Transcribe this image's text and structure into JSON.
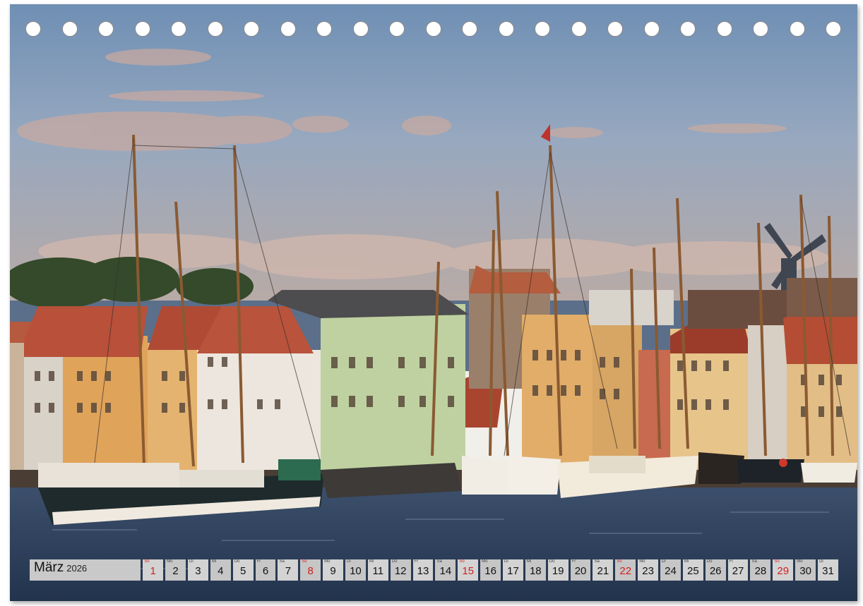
{
  "calendar": {
    "month": "März",
    "year": "2026",
    "sunday_color": "#d41f1f",
    "days": [
      {
        "dow": "So",
        "num": "1",
        "sunday": true
      },
      {
        "dow": "Mo",
        "num": "2",
        "sunday": false
      },
      {
        "dow": "Di",
        "num": "3",
        "sunday": false
      },
      {
        "dow": "Mi",
        "num": "4",
        "sunday": false
      },
      {
        "dow": "Do",
        "num": "5",
        "sunday": false
      },
      {
        "dow": "Fr",
        "num": "6",
        "sunday": false
      },
      {
        "dow": "Sa",
        "num": "7",
        "sunday": false
      },
      {
        "dow": "So",
        "num": "8",
        "sunday": true
      },
      {
        "dow": "Mo",
        "num": "9",
        "sunday": false
      },
      {
        "dow": "Di",
        "num": "10",
        "sunday": false
      },
      {
        "dow": "Mi",
        "num": "11",
        "sunday": false
      },
      {
        "dow": "Do",
        "num": "12",
        "sunday": false
      },
      {
        "dow": "Fr",
        "num": "13",
        "sunday": false
      },
      {
        "dow": "Sa",
        "num": "14",
        "sunday": false
      },
      {
        "dow": "So",
        "num": "15",
        "sunday": true
      },
      {
        "dow": "Mo",
        "num": "16",
        "sunday": false
      },
      {
        "dow": "Di",
        "num": "17",
        "sunday": false
      },
      {
        "dow": "Mi",
        "num": "18",
        "sunday": false
      },
      {
        "dow": "Do",
        "num": "19",
        "sunday": false
      },
      {
        "dow": "Fr",
        "num": "20",
        "sunday": false
      },
      {
        "dow": "Sa",
        "num": "21",
        "sunday": false
      },
      {
        "dow": "So",
        "num": "22",
        "sunday": true
      },
      {
        "dow": "Mo",
        "num": "23",
        "sunday": false
      },
      {
        "dow": "Di",
        "num": "24",
        "sunday": false
      },
      {
        "dow": "Mi",
        "num": "25",
        "sunday": false
      },
      {
        "dow": "Do",
        "num": "26",
        "sunday": false
      },
      {
        "dow": "Fr",
        "num": "27",
        "sunday": false
      },
      {
        "dow": "Sa",
        "num": "28",
        "sunday": false
      },
      {
        "dow": "So",
        "num": "29",
        "sunday": true
      },
      {
        "dow": "Mo",
        "num": "30",
        "sunday": false
      },
      {
        "dow": "Di",
        "num": "31",
        "sunday": false
      }
    ]
  },
  "binding": {
    "hole_count": 23
  }
}
